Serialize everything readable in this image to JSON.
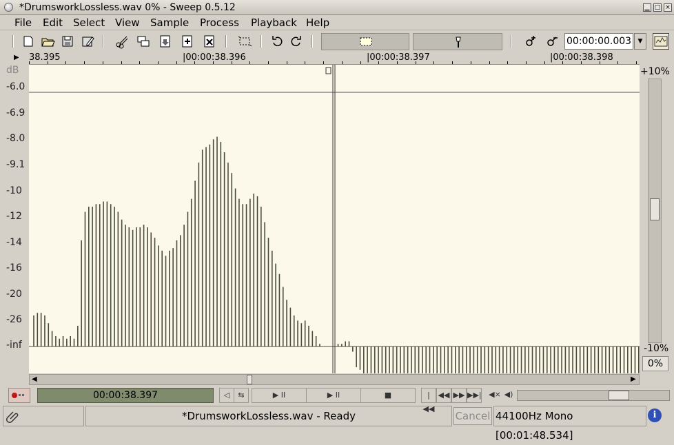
{
  "window": {
    "title": "*DrumsworkLossless.wav 0% - Sweep 0.5.12"
  },
  "menu": {
    "items": [
      "File",
      "Edit",
      "Select",
      "View",
      "Sample",
      "Process",
      "Playback",
      "Help"
    ]
  },
  "toolbar": {
    "icons": [
      "new-file-icon",
      "open-file-icon",
      "save-icon",
      "save-as-icon",
      "cut-icon",
      "copy-icon",
      "paste-icon",
      "paste-mix-icon",
      "paste-crossfade-icon",
      "crop-icon",
      "undo-icon",
      "redo-icon",
      "select-mode-icon",
      "scrub-mode-icon",
      "zoom-in-icon",
      "zoom-out-icon"
    ],
    "time_value": "00:00:00.003",
    "combo_arrow": "▼"
  },
  "ruler": {
    "labels": [
      "38.395",
      "|00:00:38.396",
      "|00:00:38.397",
      "|00:00:38.398"
    ]
  },
  "db_scale": {
    "unit": "dB",
    "labels": [
      "-6.0",
      "-6.9",
      "-8.0",
      "-9.1",
      "-10",
      "-12",
      "-14",
      "-16",
      "-20",
      "-26",
      "-inf"
    ]
  },
  "vertical_zoom": {
    "top_label": "+10%",
    "bottom_label": "-10%",
    "reset_label": "0%"
  },
  "transport": {
    "position": "00:00:38.397",
    "buttons": [
      "◁",
      "⇆",
      "▶ II",
      "▶ II",
      "■",
      "|◀◀",
      "◀◀",
      "▶▶",
      "▶▶|",
      "◀×",
      "◀)"
    ]
  },
  "status": {
    "message": "*DrumsworkLossless.wav - Ready",
    "cancel_label": "Cancel",
    "format_info": "44100Hz Mono [00:01:48.534]",
    "info_glyph": "i"
  },
  "colors": {
    "canvas_bg": "#fcf8ea",
    "waveform": "#4a4c3a",
    "position_display": "#7f8b6c"
  },
  "waveform": {
    "bar_tops_db_index": [
      9.8,
      9.7,
      9.7,
      9.8,
      10.1,
      10.4,
      10.6,
      10.7,
      10.6,
      10.7,
      10.6,
      10.7,
      10.2,
      6.9,
      5.8,
      5.6,
      5.6,
      5.5,
      5.5,
      5.4,
      5.4,
      5.5,
      5.6,
      5.8,
      6.1,
      6.3,
      6.4,
      6.5,
      6.4,
      6.4,
      6.3,
      6.4,
      6.6,
      6.8,
      7.1,
      7.3,
      7.5,
      7.3,
      7.2,
      6.9,
      6.7,
      6.3,
      5.8,
      5.3,
      4.6,
      3.9,
      3.4,
      3.3,
      3.2,
      3.0,
      2.9,
      3.1,
      3.5,
      3.9,
      4.3,
      4.9,
      5.3,
      5.5,
      5.5,
      5.3,
      5.1,
      5.2,
      5.6,
      6.2,
      6.8,
      7.3,
      7.8,
      8.2,
      8.7,
      9.2,
      9.5,
      9.8,
      10.0,
      10.1,
      10.0,
      10.2,
      10.4,
      10.6,
      10.9,
      11.0,
      11.0,
      11.0,
      11.0,
      10.9,
      10.9,
      10.8,
      10.8,
      11.2,
      11.8,
      11.9
    ]
  }
}
